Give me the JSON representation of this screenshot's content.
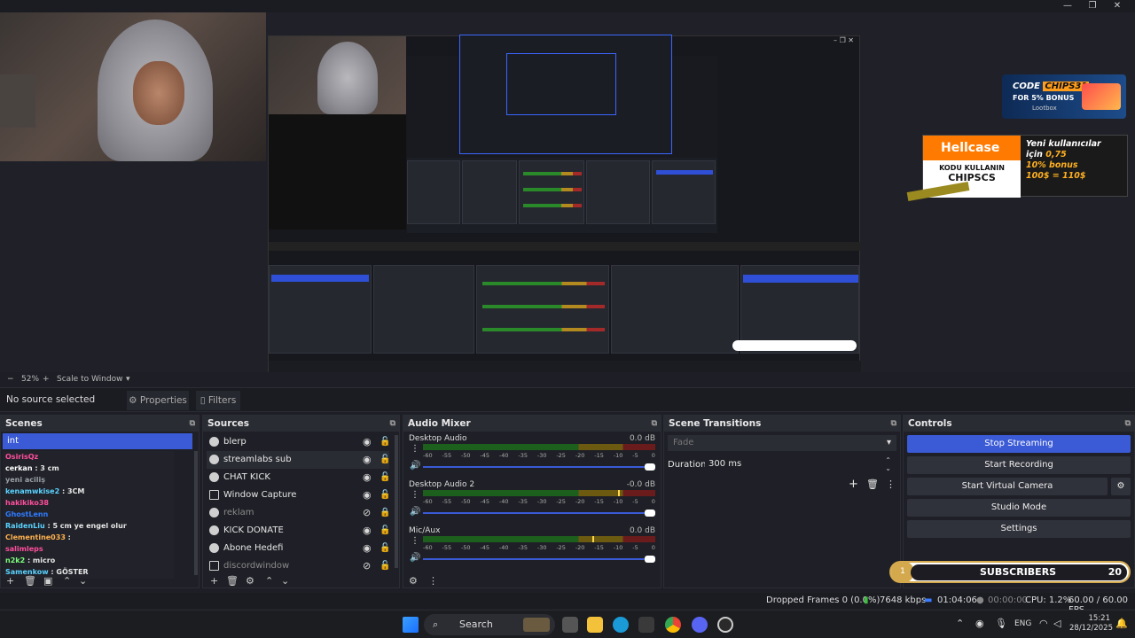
{
  "window": {
    "minimize": "—",
    "maximize": "❐",
    "close": "✕"
  },
  "preview": {
    "nested_window_controls": "– ❐ ✕",
    "ad_code": {
      "line1": "CODE",
      "code": "CHIPS31",
      "line2": "FOR 5% BONUS",
      "brand": "Lootbox"
    },
    "ad_hellcase": {
      "logo": "Hellcase",
      "sub1": "KODU KULLANIN",
      "sub2": "CHIPSCS",
      "line1": "Yeni kullanıcılar",
      "line2_prefix": "için",
      "line2_value": "0,75",
      "line3": "10% bonus",
      "line4": "100$ = 110$"
    }
  },
  "zoombar": {
    "minus": "−",
    "zoom": "52%",
    "plus": "+",
    "mode": "Scale to Window",
    "caret": "▾"
  },
  "source_toolbar": {
    "no_source": "No source selected",
    "properties": "Properties",
    "filters": "Filters"
  },
  "scenes": {
    "title": "Scenes",
    "selected": "int",
    "chat": [
      {
        "user": "OsirisQz",
        "msg": "",
        "color": "#ff4e9d"
      },
      {
        "user": "cerkan",
        "msg": " : 3 cm",
        "color": "#ffffff"
      },
      {
        "user": "yeni aciliş",
        "msg": "",
        "color": "#9aa0a6"
      },
      {
        "user": "kenamwkise2",
        "msg": " : 3CM",
        "color": "#5ad3ff"
      },
      {
        "user": "hakikiko38",
        "msg": "",
        "color": "#ff4e9d"
      },
      {
        "user": "GhostLenn",
        "msg": "",
        "color": "#2f7bff"
      },
      {
        "user": "RaidenLiu",
        "msg": " : 5 cm ye engel olur",
        "color": "#5ad3ff"
      },
      {
        "user": "Clementine033",
        "msg": " :",
        "color": "#ffb14e"
      },
      {
        "user": "salimleps",
        "msg": "",
        "color": "#ff4e9d"
      },
      {
        "user": "n2k2",
        "msg": " : micro",
        "color": "#7bff7b"
      },
      {
        "user": "Samenkow",
        "msg": " : GÖSTER",
        "color": "#5ad3ff"
      }
    ],
    "footer": [
      "+",
      "🗑",
      "▣",
      "⌃",
      "⌄"
    ]
  },
  "sources": {
    "title": "Sources",
    "items": [
      {
        "name": "blerp",
        "icon": "globe-icon",
        "visible": true,
        "locked": false
      },
      {
        "name": "streamlabs sub",
        "icon": "globe-icon",
        "visible": true,
        "locked": false
      },
      {
        "name": "CHAT KICK",
        "icon": "globe-icon",
        "visible": true,
        "locked": false
      },
      {
        "name": "Window Capture",
        "icon": "window-icon",
        "visible": true,
        "locked": false
      },
      {
        "name": "reklam",
        "icon": "globe-icon",
        "visible": false,
        "locked": true
      },
      {
        "name": "KICK DONATE",
        "icon": "globe-icon",
        "visible": true,
        "locked": false
      },
      {
        "name": "Abone Hedefi",
        "icon": "globe-icon",
        "visible": true,
        "locked": false
      },
      {
        "name": "discordwindow",
        "icon": "window-icon",
        "visible": false,
        "locked": false
      }
    ],
    "footer": [
      "+",
      "🗑",
      "⚙",
      "⌃",
      "⌄"
    ]
  },
  "mixer": {
    "title": "Audio Mixer",
    "scale": [
      "-60",
      "-55",
      "-50",
      "-45",
      "-40",
      "-35",
      "-30",
      "-25",
      "-20",
      "-15",
      "-10",
      "-5",
      "0"
    ],
    "channels": [
      {
        "name": "Desktop Audio",
        "db": "0.0 dB",
        "level": 0.0
      },
      {
        "name": "Desktop Audio 2",
        "db": "-0.0 dB",
        "level": 0.84
      },
      {
        "name": "Mic/Aux",
        "db": "0.0 dB",
        "level": 0.73
      }
    ]
  },
  "transitions": {
    "title": "Scene Transitions",
    "selected": "Fade",
    "duration_label": "Duration",
    "duration_value": "300 ms"
  },
  "controls": {
    "title": "Controls",
    "stop_streaming": "Stop Streaming",
    "start_recording": "Start Recording",
    "start_virtual_camera": "Start Virtual Camera",
    "studio_mode": "Studio Mode",
    "settings": "Settings"
  },
  "subs_widget": {
    "label": "SUBSCRIBERS",
    "count": "20",
    "coin": "1"
  },
  "status": {
    "dropped": "Dropped Frames 0 (0.0%)",
    "kbps": "7648 kbps",
    "live_time": "01:04:06",
    "rec_time": "00:00:00",
    "cpu": "CPU: 1.2%",
    "fps": "60.00 / 60.00 FPS"
  },
  "taskbar": {
    "search": "Search",
    "lang": "ENG",
    "time": "15:21",
    "date": "28/12/2025"
  },
  "colors": {
    "accent": "#3a5ad6",
    "panel": "#1f2027",
    "header": "#2a2c34"
  }
}
